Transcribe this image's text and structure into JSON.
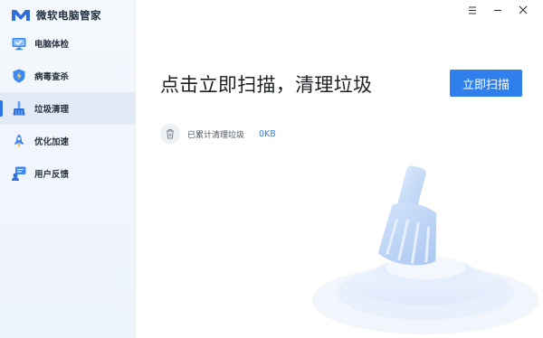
{
  "app": {
    "title": "微软电脑管家"
  },
  "sidebar": {
    "items": [
      {
        "label": "电脑体检",
        "icon": "monitor-check-icon",
        "active": false
      },
      {
        "label": "病毒查杀",
        "icon": "shield-bolt-icon",
        "active": false
      },
      {
        "label": "垃圾清理",
        "icon": "broom-icon",
        "active": true
      },
      {
        "label": "优化加速",
        "icon": "rocket-icon",
        "active": false
      },
      {
        "label": "用户反馈",
        "icon": "feedback-icon",
        "active": false
      }
    ]
  },
  "window": {
    "menu_icon": "menu-icon",
    "minimize_icon": "minimize-icon",
    "close_icon": "close-icon"
  },
  "main": {
    "headline": "点击立即扫描，清理垃圾",
    "scan_button": "立即扫描",
    "stats": {
      "label": "已累计清理垃圾",
      "value": "0KB"
    }
  },
  "colors": {
    "accent": "#2f80ed",
    "sidebar_bg": "#f0f5fb",
    "active_bg": "#e2eaf5"
  }
}
